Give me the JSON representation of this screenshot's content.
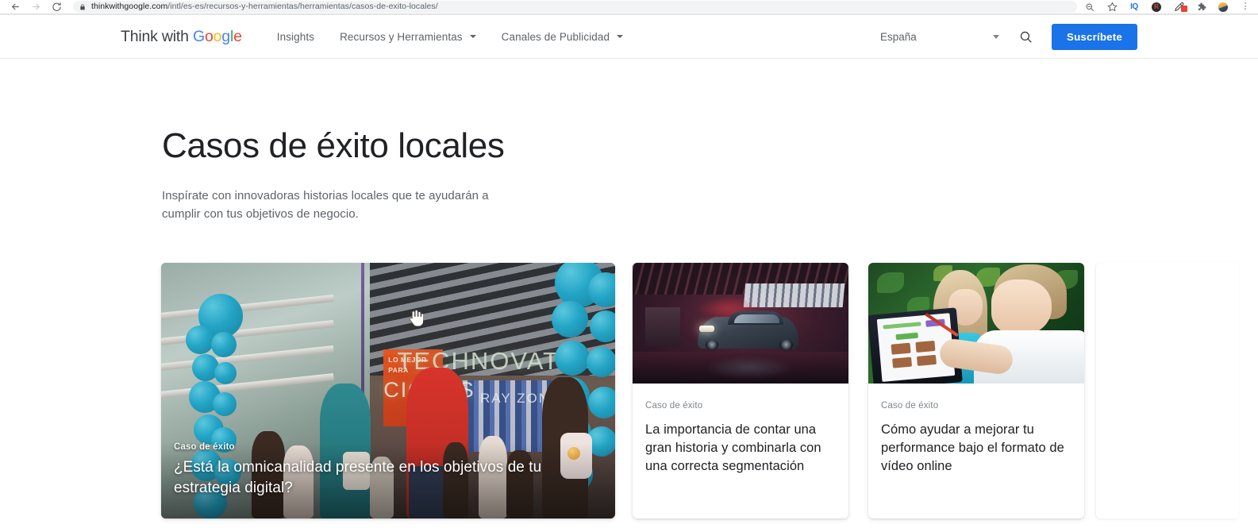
{
  "browser": {
    "back_icon": "back-arrow-icon",
    "forward_icon": "forward-arrow-icon",
    "reload_icon": "reload-icon",
    "lock_icon": "lock-icon",
    "url_domain": "thinkwithgoogle.com",
    "url_path": "/intl/es-es/recursos-y-herramientas/herramientas/casos-de-exito-locales/",
    "toolbar_icons": [
      {
        "name": "zoom-icon",
        "label": ""
      },
      {
        "name": "bookmark-star-icon",
        "label": ""
      },
      {
        "name": "extension-iq-icon",
        "label": "IQ"
      },
      {
        "name": "extension-dark-circle-icon",
        "label": "R"
      },
      {
        "name": "extension-eyedropper-icon",
        "label": ""
      },
      {
        "name": "extensions-puzzle-icon",
        "label": ""
      },
      {
        "name": "profile-avatar-icon",
        "label": ""
      },
      {
        "name": "chrome-menu-icon",
        "label": "⋮"
      }
    ]
  },
  "header": {
    "logo": {
      "prefix": "Think with ",
      "g1": "G",
      "o1": "o",
      "o2": "o",
      "g2": "g",
      "l": "l",
      "e": "e"
    },
    "nav": [
      {
        "label": "Insights",
        "has_caret": false
      },
      {
        "label": "Recursos y Herramientas",
        "has_caret": true
      },
      {
        "label": "Canales de Publicidad",
        "has_caret": true
      }
    ],
    "country": "España",
    "search_icon": "search-icon",
    "subscribe_label": "Suscríbete",
    "accent_color": "#1a73e8"
  },
  "hero": {
    "title": "Casos de éxito locales",
    "subtitle": "Inspírate con innovadoras historias locales que te ayudarán a cumplir con tus objetivos de negocio."
  },
  "cards": [
    {
      "kicker": "Caso de éxito",
      "title": "¿Está la omnicanalidad presente en los objetivos de tu estrategia digital?",
      "image_alt": "store-opening-with-teal-balloons-photo",
      "image_signage": "TECHNOVATI",
      "image_signage2": "CIONES",
      "image_signage3": "RAY ZONE",
      "image_poster": "LO MEJOR PARA",
      "layout": "large-overlay"
    },
    {
      "kicker": "Caso de éxito",
      "title": "La importancia de contar una gran historia y combinarla con una correcta segmentación",
      "image_alt": "dark-car-in-warehouse-photo",
      "layout": "small"
    },
    {
      "kicker": "Caso de éxito",
      "title": "Cómo ayudar a mejorar tu performance bajo el formato de vídeo online",
      "image_alt": "two-children-using-tablet-outdoors-photo",
      "layout": "small"
    }
  ],
  "cursor": {
    "icon": "pointer-hand-cursor"
  }
}
